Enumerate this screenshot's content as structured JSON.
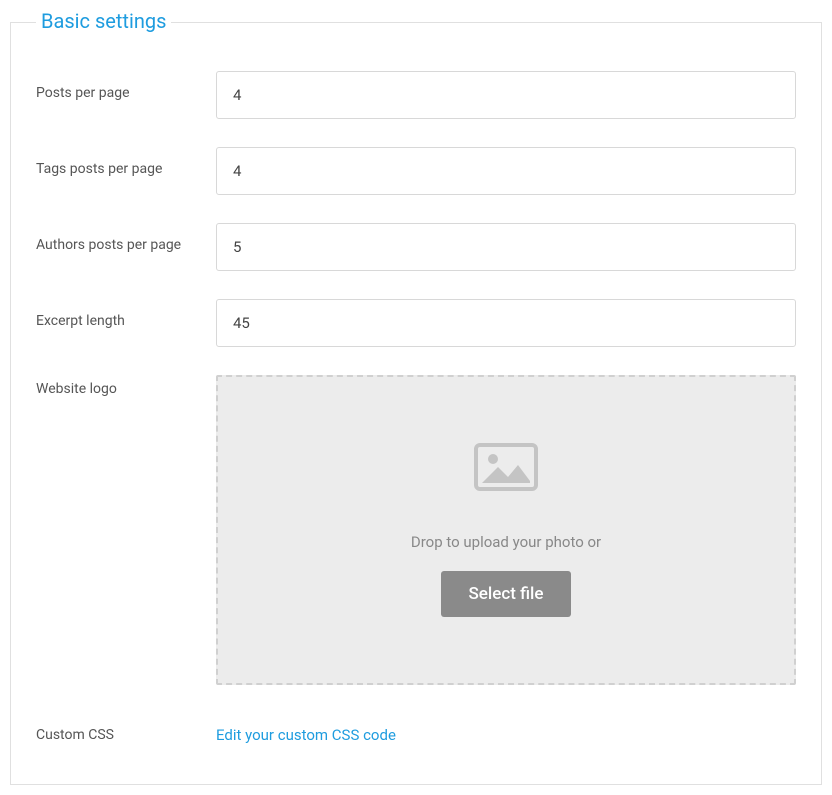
{
  "fieldset": {
    "title": "Basic settings"
  },
  "fields": {
    "postsPerPage": {
      "label": "Posts per page",
      "value": "4"
    },
    "tagsPostsPerPage": {
      "label": "Tags posts per page",
      "value": "4"
    },
    "authorsPostsPerPage": {
      "label": "Authors posts per page",
      "value": "5"
    },
    "excerptLength": {
      "label": "Excerpt length",
      "value": "45"
    },
    "websiteLogo": {
      "label": "Website logo",
      "dropText": "Drop to upload your photo or",
      "buttonLabel": "Select file"
    },
    "customCss": {
      "label": "Custom CSS",
      "linkText": "Edit your custom CSS code"
    }
  }
}
